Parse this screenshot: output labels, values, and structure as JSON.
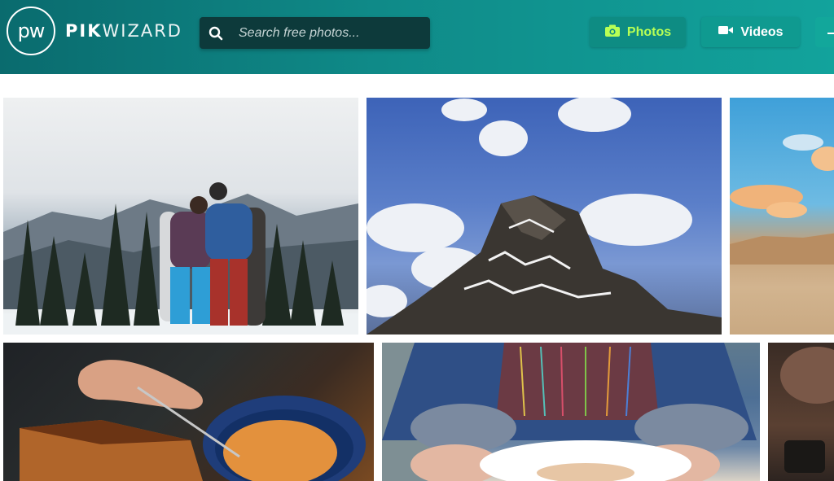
{
  "header": {
    "logo_mark": "pw",
    "brand_bold": "PIK",
    "brand_light": "WIZARD"
  },
  "search": {
    "placeholder": "Search free photos...",
    "icon": "search-icon"
  },
  "nav": {
    "photos_label": "Photos",
    "photos_icon": "camera-icon",
    "videos_label": "Videos",
    "videos_icon": "video-camera-icon"
  },
  "colors": {
    "header_start": "#0a6b6e",
    "header_end": "#12a39c",
    "accent_green": "#b8ff55",
    "search_bg": "#0d3a3b"
  },
  "gallery": {
    "photos": [
      {
        "name": "couple-snowboarders-mountains"
      },
      {
        "name": "snowy-mountain-peak-clouds"
      },
      {
        "name": "desert-dunes-sky"
      },
      {
        "name": "toast-and-pasta-bowl"
      },
      {
        "name": "person-holding-sprinkle-plate"
      },
      {
        "name": "partial-photo"
      }
    ]
  }
}
